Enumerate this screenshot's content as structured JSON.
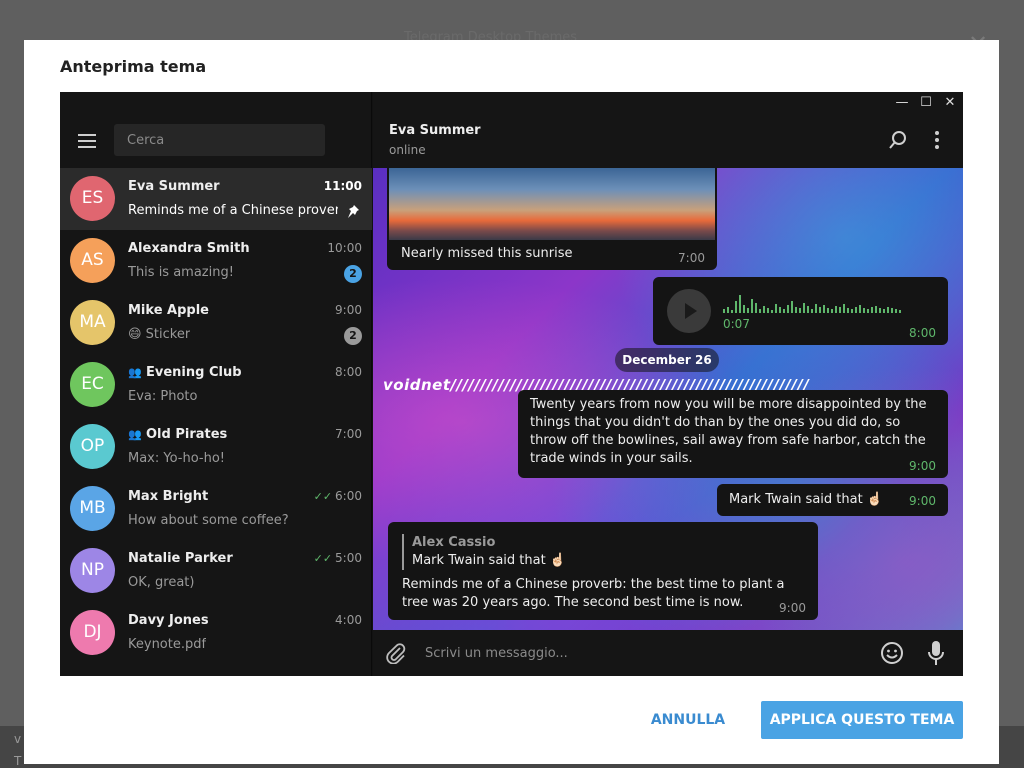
{
  "background": {
    "title": "Telegram Desktop Themes",
    "close_glyph": "✕",
    "bottom_text": "v\nT"
  },
  "modal": {
    "title": "Anteprima tema",
    "cancel_label": "ANNULLA",
    "apply_label": "APPLICA QUESTO TEMA"
  },
  "window_controls": {
    "minimize": "—",
    "maximize": "☐",
    "close": "✕"
  },
  "sidebar": {
    "search_placeholder": "Cerca",
    "chats": [
      {
        "initials": "ES",
        "name": "Eva Summer",
        "time": "11:00",
        "preview": "Reminds me of a Chinese proverb...",
        "avatar_color": "#e06670",
        "pinned": true,
        "active": true
      },
      {
        "initials": "AS",
        "name": "Alexandra Smith",
        "time": "10:00",
        "preview": "This is amazing!",
        "avatar_color": "#f5a05a",
        "badge": "2",
        "badge_color": "#4aa3e4"
      },
      {
        "initials": "MA",
        "name": "Mike Apple",
        "time": "9:00",
        "preview": "😄 Sticker",
        "avatar_color": "#e5c56a",
        "badge": "2",
        "badge_color": "#9a9a9a"
      },
      {
        "initials": "EC",
        "name": "Evening Club",
        "time": "8:00",
        "preview": "Eva: Photo",
        "avatar_color": "#6fc65e",
        "group": true
      },
      {
        "initials": "OP",
        "name": "Old Pirates",
        "time": "7:00",
        "preview": "Max: Yo-ho-ho!",
        "avatar_color": "#5ac9d0",
        "group": true
      },
      {
        "initials": "MB",
        "name": "Max Bright",
        "time": "6:00",
        "preview": "How about some coffee?",
        "avatar_color": "#5aa5e6",
        "read": true
      },
      {
        "initials": "NP",
        "name": "Natalie Parker",
        "time": "5:00",
        "preview": "OK, great)",
        "avatar_color": "#9d86e6",
        "read": true
      },
      {
        "initials": "DJ",
        "name": "Davy Jones",
        "time": "4:00",
        "preview": "Keynote.pdf",
        "avatar_color": "#ee7aae"
      }
    ]
  },
  "header": {
    "name": "Eva Summer",
    "status": "online"
  },
  "messages": {
    "photo_caption": "Nearly missed this sunrise",
    "photo_time": "7:00",
    "voice_duration": "0:07",
    "voice_time": "8:00",
    "date_separator": "December 26",
    "wallpaper_text": "voidnet////////////////////////////////////////////////////////////",
    "quote_text": "Twenty years from now you will be more disappointed by the things that you didn't do than by the ones you did do, so throw off the bowlines, sail away from safe harbor, catch the trade winds in your sails.",
    "quote_time": "9:00",
    "twain_text": "Mark Twain said that ☝🏻",
    "twain_time": "9:00",
    "reply_author": "Alex Cassio",
    "reply_quoted": "Mark Twain said that ☝🏻",
    "reply_text": "Reminds me of a Chinese proverb: the best time to plant a tree was 20 years ago. The second best time is now.",
    "reply_time": "9:00"
  },
  "composer": {
    "placeholder": "Scrivi un messaggio..."
  },
  "colors": {
    "accent": "#4aa3e4",
    "read_tick": "#5fb76b",
    "dark_bg": "#151515"
  },
  "icons": [
    "menu-icon",
    "search-icon",
    "more-icon",
    "pin-icon",
    "group-icon",
    "play-icon",
    "attach-icon",
    "emoji-icon",
    "mic-icon"
  ]
}
